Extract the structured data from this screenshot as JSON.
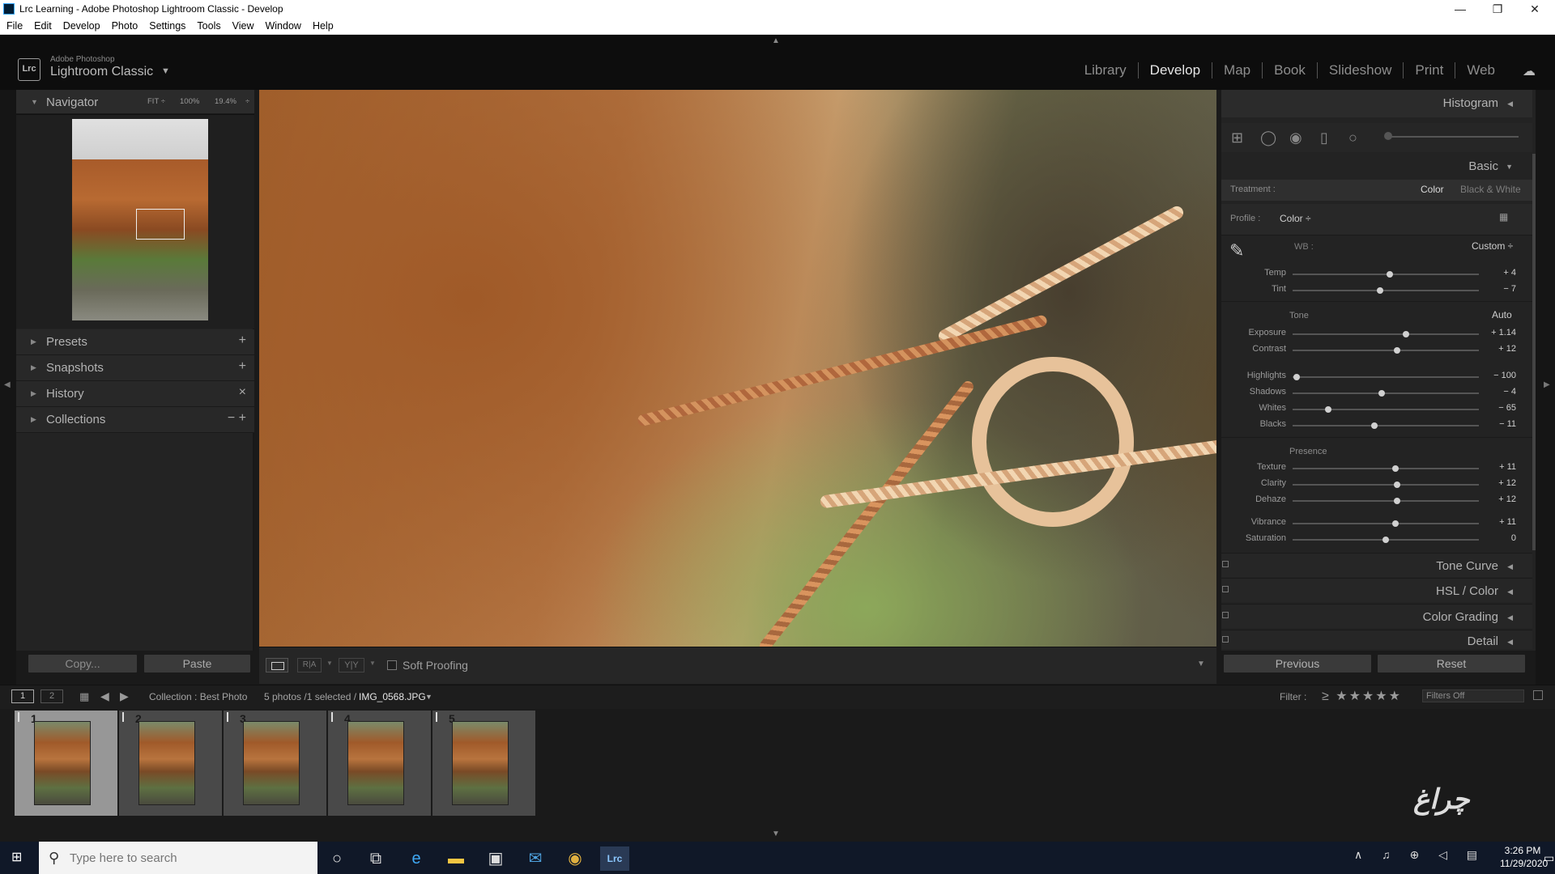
{
  "window": {
    "title": "Lrc Learning - Adobe Photoshop Lightroom Classic - Develop"
  },
  "menu": [
    "File",
    "Edit",
    "Develop",
    "Photo",
    "Settings",
    "Tools",
    "View",
    "Window",
    "Help"
  ],
  "brand": {
    "line1": "Adobe Photoshop",
    "line2": "Lightroom Classic",
    "logo": "Lrc"
  },
  "modules": [
    "Library",
    "Develop",
    "Map",
    "Book",
    "Slideshow",
    "Print",
    "Web"
  ],
  "active_module": "Develop",
  "navigator": {
    "title": "Navigator",
    "zoom_fit": "FIT ÷",
    "zoom_100": "100%",
    "zoom_custom": "19.4%"
  },
  "left_panels": [
    {
      "label": "Presets",
      "action": "+"
    },
    {
      "label": "Snapshots",
      "action": "+"
    },
    {
      "label": "History",
      "action": "×"
    },
    {
      "label": "Collections",
      "action": "−  +"
    }
  ],
  "buttons": {
    "copy": "Copy...",
    "paste": "Paste",
    "previous": "Previous",
    "reset": "Reset"
  },
  "toolbar": {
    "soft_proofing": "Soft Proofing"
  },
  "right_panel": {
    "histogram": "Histogram",
    "basic": "Basic",
    "treatment_label": "Treatment :",
    "treatment_color": "Color",
    "treatment_bw": "Black & White",
    "profile_label": "Profile :",
    "profile_value": "Color ÷",
    "wb_label": "WB :",
    "wb_value": "Custom ÷",
    "tone_label": "Tone",
    "tone_auto": "Auto",
    "presence_label": "Presence",
    "collapsed": [
      "Tone Curve",
      "HSL / Color",
      "Color Grading",
      "Detail"
    ]
  },
  "sliders": [
    {
      "label": "Temp",
      "value": "+ 4",
      "pos": 0.52
    },
    {
      "label": "Tint",
      "value": "− 7",
      "pos": 0.47
    },
    {
      "label": "Exposure",
      "value": "+ 1.14",
      "pos": 0.61
    },
    {
      "label": "Contrast",
      "value": "+ 12",
      "pos": 0.56
    },
    {
      "label": "Highlights",
      "value": "− 100",
      "pos": 0.02
    },
    {
      "label": "Shadows",
      "value": "− 4",
      "pos": 0.48
    },
    {
      "label": "Whites",
      "value": "− 65",
      "pos": 0.19
    },
    {
      "label": "Blacks",
      "value": "− 11",
      "pos": 0.44
    },
    {
      "label": "Texture",
      "value": "+ 11",
      "pos": 0.55
    },
    {
      "label": "Clarity",
      "value": "+ 12",
      "pos": 0.56
    },
    {
      "label": "Dehaze",
      "value": "+ 12",
      "pos": 0.56
    },
    {
      "label": "Vibrance",
      "value": "+ 11",
      "pos": 0.55
    },
    {
      "label": "Saturation",
      "value": "0",
      "pos": 0.5
    }
  ],
  "filmstrip": {
    "view1": "1",
    "view2": "2",
    "collection": "Collection : Best Photo",
    "count": "5 photos /1 selected /",
    "filename": "IMG_0568.JPG",
    "filter_label": "Filter :",
    "filter_value": "Filters Off",
    "thumbnails": [
      "1",
      "2",
      "3",
      "4",
      "5"
    ],
    "selected_index": 0
  },
  "taskbar": {
    "search_placeholder": "Type here to search",
    "time": "3:26 PM",
    "date": "11/29/2020"
  }
}
